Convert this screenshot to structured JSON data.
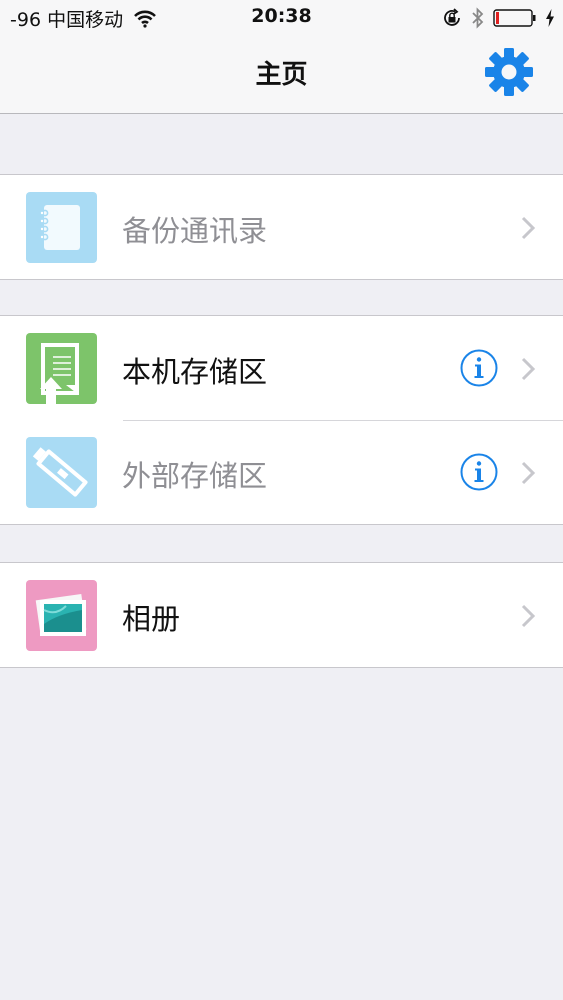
{
  "status_bar": {
    "carrier": "-96 中国移动",
    "time": "20:38",
    "icons": [
      "wifi-icon",
      "orientation-lock-icon",
      "bluetooth-icon",
      "battery-icon",
      "charging-bolt-icon"
    ]
  },
  "nav": {
    "title": "主页",
    "settings_icon": "gear-icon"
  },
  "sections": [
    {
      "items": [
        {
          "label": "备份通讯录",
          "icon": "contacts-notebook-icon",
          "enabled": false,
          "info": false
        }
      ]
    },
    {
      "items": [
        {
          "label": "本机存储区",
          "icon": "local-storage-icon",
          "enabled": true,
          "info": true
        },
        {
          "label": "外部存储区",
          "icon": "external-storage-icon",
          "enabled": false,
          "info": true
        }
      ]
    },
    {
      "items": [
        {
          "label": "相册",
          "icon": "photo-album-icon",
          "enabled": true,
          "info": false
        }
      ]
    }
  ],
  "colors": {
    "accent": "#1a84e8",
    "background": "#efeff4",
    "tile_contacts": "#a9dbf4",
    "tile_local": "#7dc46a",
    "tile_external": "#a9dbf4",
    "tile_album": "#ee9ac2"
  }
}
